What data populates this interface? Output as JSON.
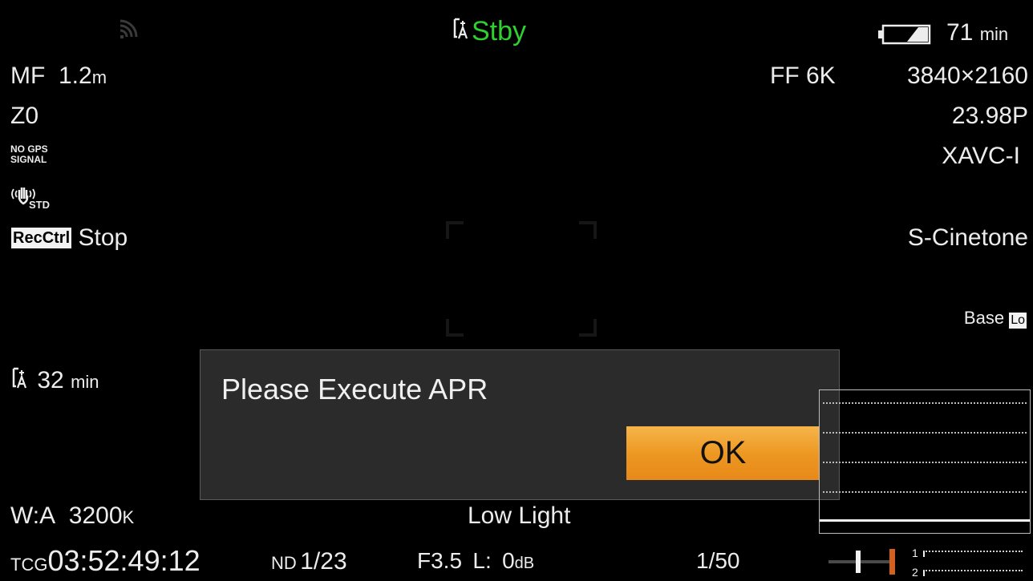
{
  "colors": {
    "green": "#2fd02f",
    "dialog_bg": "#2b2b2b",
    "ok_orange": "#ec9620",
    "text": "#ececec"
  },
  "top": {
    "status": "Stby",
    "battery_value": "71",
    "battery_unit": "min",
    "wifi_icon": "wifi-icon"
  },
  "left": {
    "focus_mode": "MF",
    "focus_value": "1.2",
    "focus_unit": "m",
    "zoom": "Z0",
    "gps_line1": "NO GPS",
    "gps_line2": "SIGNAL",
    "stabilizer": "STD",
    "rec_ctrl_badge": "RecCtrl",
    "rec_ctrl_value": "Stop",
    "media_remaining_value": "32",
    "media_remaining_unit": "min",
    "white_balance_label": "W:A",
    "white_balance_value": "3200",
    "white_balance_unit": "K"
  },
  "right": {
    "sensor_mode": "FF 6K",
    "resolution": "3840×2160",
    "frame_rate": "23.98P",
    "codec": "XAVC-I",
    "look": "S-Cinetone",
    "base_label": "Base",
    "base_badge": "Lo"
  },
  "center": {
    "low_light": "Low Light"
  },
  "dialog": {
    "message": "Please Execute APR",
    "ok_label": "OK"
  },
  "bottom": {
    "tc_label": "TCG",
    "timecode": "03:52:49:12",
    "nd_label": "ND",
    "nd_value": "1/23",
    "iris": "F3.5",
    "gain_label": "L:",
    "gain_value": "0",
    "gain_unit": "dB",
    "shutter": "1/50",
    "audio_ch1": "1",
    "audio_ch2": "2"
  }
}
